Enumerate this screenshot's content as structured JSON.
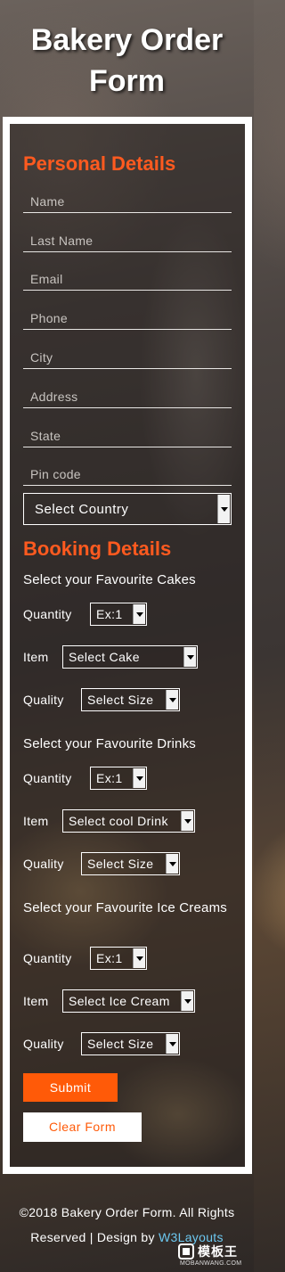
{
  "header": {
    "title": "Bakery Order Form"
  },
  "personal": {
    "section_title": "Personal Details",
    "fields": [
      {
        "placeholder": "Name",
        "value": ""
      },
      {
        "placeholder": "Last Name",
        "value": ""
      },
      {
        "placeholder": "Email",
        "value": ""
      },
      {
        "placeholder": "Phone",
        "value": ""
      },
      {
        "placeholder": "City",
        "value": ""
      },
      {
        "placeholder": "Address",
        "value": ""
      },
      {
        "placeholder": "State",
        "value": ""
      },
      {
        "placeholder": "Pin code",
        "value": ""
      }
    ],
    "country_select": "Select Country"
  },
  "booking": {
    "section_title": "Booking Details",
    "groups": [
      {
        "label": "Select your Favourite Cakes",
        "quantity_label": "Quantity",
        "quantity_value": "Ex:1",
        "item_label": "Item",
        "item_value": "Select Cake",
        "quality_label": "Quality",
        "quality_value": "Select Size"
      },
      {
        "label": "Select your Favourite Drinks",
        "quantity_label": "Quantity",
        "quantity_value": "Ex:1",
        "item_label": "Item",
        "item_value": "Select cool Drink",
        "quality_label": "Quality",
        "quality_value": "Select Size"
      },
      {
        "label": "Select your Favourite Ice Creams",
        "quantity_label": "Quantity",
        "quantity_value": "Ex:1",
        "item_label": "Item",
        "item_value": "Select Ice Cream",
        "quality_label": "Quality",
        "quality_value": "Select Size"
      }
    ]
  },
  "actions": {
    "submit_label": "Submit",
    "clear_label": "Clear Form"
  },
  "footer": {
    "text": "©2018 Bakery Order Form. All Rights Reserved | Design by",
    "link": "W3Layouts"
  },
  "watermark": {
    "cn": "模板王",
    "en": "MOBANWANG.COM"
  },
  "colors": {
    "accent": "#ff5a08",
    "link": "#6cc8f0"
  }
}
